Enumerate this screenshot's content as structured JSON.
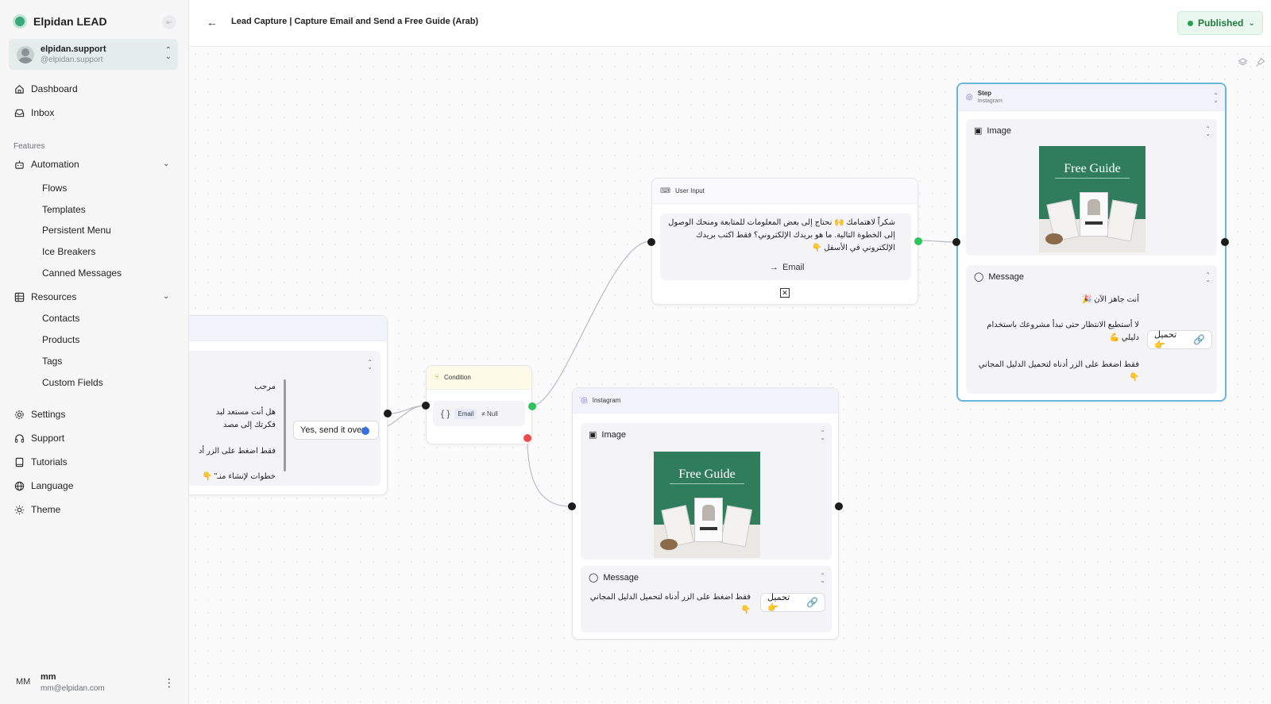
{
  "app": {
    "brand": "Elpidan LEAD",
    "collapse_icon": "sidebar-collapse-icon"
  },
  "account": {
    "name": "elpidan.support",
    "handle": "@elpidan.support"
  },
  "nav": {
    "dashboard": "Dashboard",
    "inbox": "Inbox",
    "features_heading": "Features",
    "automation": "Automation",
    "automation_items": [
      "Flows",
      "Templates",
      "Persistent Menu",
      "Ice Breakers",
      "Canned Messages"
    ],
    "resources": "Resources",
    "resources_items": [
      "Contacts",
      "Products",
      "Tags",
      "Custom Fields"
    ],
    "settings": "Settings",
    "support": "Support",
    "tutorials": "Tutorials",
    "language": "Language",
    "theme": "Theme"
  },
  "user": {
    "initials": "MM",
    "name": "mm",
    "email": "mm@elpidan.com"
  },
  "header": {
    "title": "Lead Capture | Capture Email and Send a Free Guide (Arab)",
    "status": "Published",
    "status_color": "#22a34d"
  },
  "nodes": {
    "left_message": {
      "lines": [
        "مرحب",
        "هل أنت مستعد لبد",
        "فكرتك إلى مصد",
        "فقط اضغط على الزر أد",
        "خطوات لإنشاء منـ\" 👇"
      ],
      "button": "Yes, send it over!"
    },
    "condition": {
      "title": "Condition",
      "field": "Email",
      "operator": "≠ Null",
      "braces": "{ }"
    },
    "user_input": {
      "title": "User Input",
      "message": "شكراً لاهتمامك 🙌 نحتاج إلى بعض المعلومات للمتابعة ومنحك الوصول إلى الخطوة التالية. ما هو بريدك الإلكتروني؟ فقط اكتب بريدك الإلكتروني في الأسفل 👇",
      "input_label": "Email"
    },
    "instagram": {
      "title": "Instagram",
      "image_label": "Image",
      "guide_title": "Free Guide",
      "message_label": "Message",
      "message": "فقط اضغط على الزر أدناه لتحميل الدليل المجاني 👇",
      "button": "تحميل 👉"
    },
    "step": {
      "title": "Step",
      "subtitle": "Instagram",
      "image_label": "Image",
      "guide_title": "Free Guide",
      "message_label": "Message",
      "line1": "أنت جاهز الآن 🎉",
      "line2": "لا أستطيع الانتظار حتى تبدأ مشروعك باستخدام دليلي 💪",
      "line3": "فقط اضغط على الزر أدناه لتحميل الدليل المجاني 👇",
      "button": "تحميل 👉"
    }
  }
}
